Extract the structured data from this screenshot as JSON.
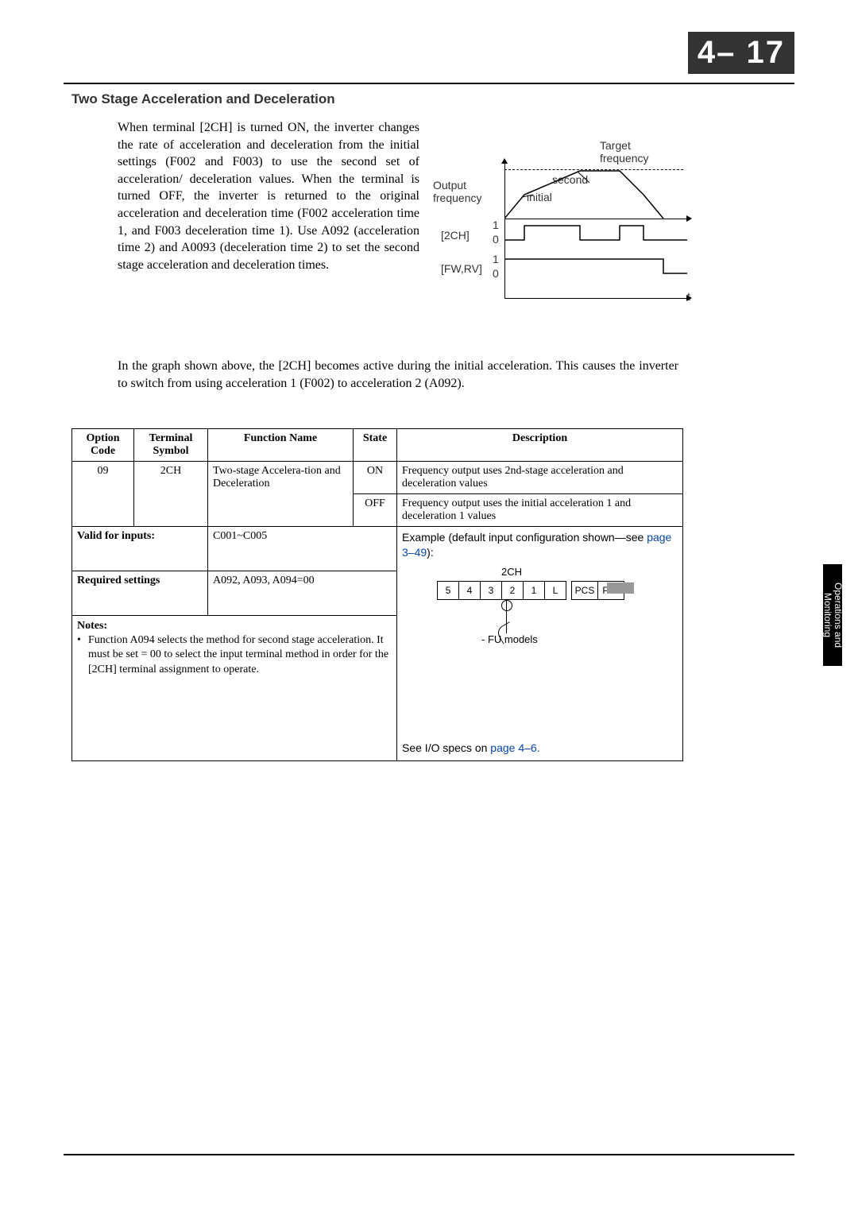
{
  "header": {
    "page_tag": "4–  17"
  },
  "section_title": "Two Stage Acceleration and Deceleration",
  "paragraph1": "When terminal [2CH] is turned ON, the inverter changes the rate of acceleration and deceleration from the initial settings (F002 and F003) to use the second set of acceleration/ deceleration values. When the terminal is turned OFF, the inverter is returned to the original acceleration and deceleration time (F002 acceleration time 1, and F003 deceleration time 1). Use A092 (acceleration time 2) and A0093 (deceleration time 2) to set the second stage acceleration and deceleration times.",
  "paragraph2": "In the graph shown above, the [2CH] becomes active during the initial acceleration. This causes the inverter to switch from using acceleration 1 (F002) to acceleration 2 (A092).",
  "diagram": {
    "out_freq": "Output\nfrequency",
    "target": "Target\nfrequency",
    "initial": "initial",
    "second": "second",
    "ch": "[2CH]",
    "fwrv": "[FW,RV]",
    "lvl1": "1",
    "lvl0": "0",
    "t": "t"
  },
  "table": {
    "headers": {
      "option": "Option Code",
      "symbol": "Terminal Symbol",
      "func": "Function Name",
      "state": "State",
      "desc": "Description"
    },
    "row1": {
      "option": "09",
      "symbol": "2CH",
      "func": "Two-stage Accelera-tion and Deceleration",
      "state_on": "ON",
      "desc_on": "Frequency output uses 2nd-stage acceleration and deceleration values",
      "state_off": "OFF",
      "desc_off": "Frequency output uses the initial acceleration 1 and deceleration 1 values"
    },
    "valid_label": "Valid for inputs:",
    "valid_value": "C001~C005",
    "req_label": "Required settings",
    "req_value": "A092, A093, A094=00",
    "notes_title": "Notes:",
    "notes_bullet": "Function A094 selects the method for second stage acceleration. It must be set = 00 to select the input terminal method in order for the [2CH] terminal assignment to operate.",
    "example_text_pre": "Example (default input configuration shown—see ",
    "example_link": "page 3–49",
    "example_text_post": "):",
    "terminals": [
      "5",
      "4",
      "3",
      "2",
      "1",
      "L",
      "PCS",
      "P24"
    ],
    "term_2ch": "2CH",
    "fu_models": "- FU models",
    "io_pre": "See I/O specs on ",
    "io_link": "page 4–6.",
    "io_post": ""
  },
  "side_tab": "Operations and Monitoring"
}
